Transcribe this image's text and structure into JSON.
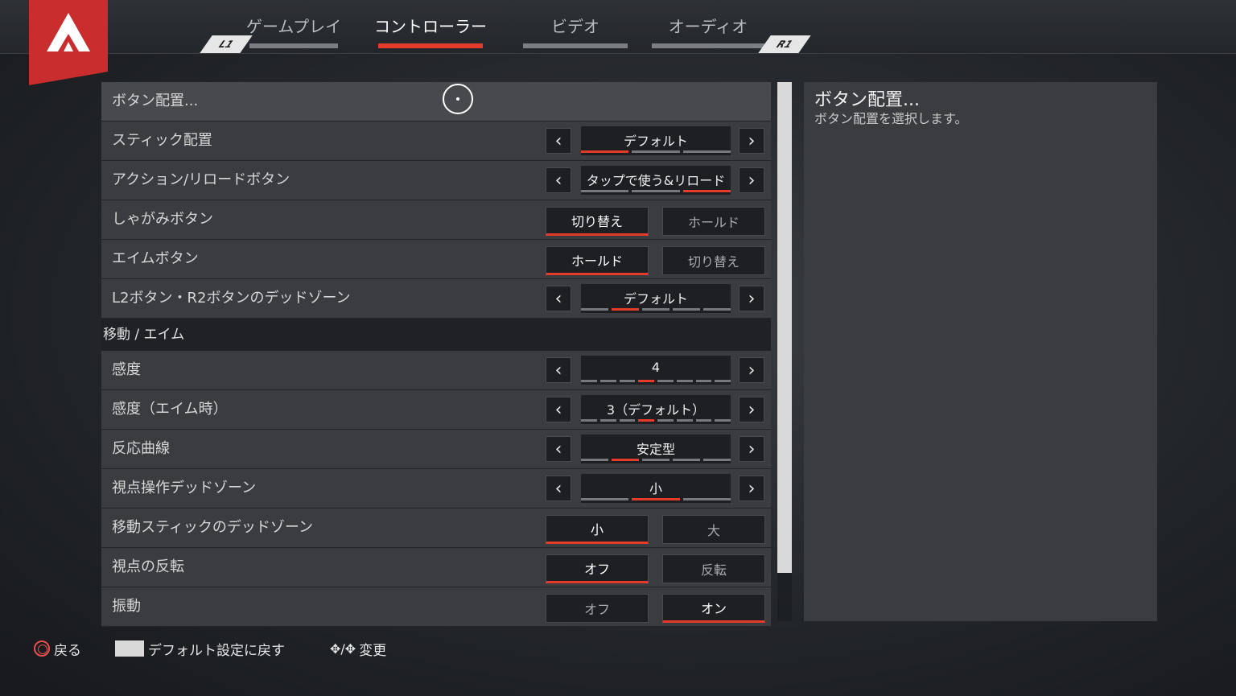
{
  "tabs": [
    {
      "label": "ゲームプレイ"
    },
    {
      "label": "コントローラー"
    },
    {
      "label": "ビデオ"
    },
    {
      "label": "オーディオ"
    }
  ],
  "shoulders": {
    "left": "L1",
    "right": "R1"
  },
  "rows_top": [
    {
      "label": "ボタン配置..."
    },
    {
      "label": "スティック配置",
      "value": "デフォルト"
    },
    {
      "label": "アクション/リロードボタン",
      "value": "タップで使う&リロード"
    },
    {
      "label": "しゃがみボタン",
      "opt_a": "切り替え",
      "opt_b": "ホールド"
    },
    {
      "label": "エイムボタン",
      "opt_a": "ホールド",
      "opt_b": "切り替え"
    },
    {
      "label": "L2ボタン・R2ボタンのデッドゾーン",
      "value": "デフォルト"
    }
  ],
  "section_move": "移動 / エイム",
  "rows_move": [
    {
      "label": "感度",
      "value": "4"
    },
    {
      "label": "感度（エイム時）",
      "value": "3（デフォルト）"
    },
    {
      "label": "反応曲線",
      "value": "安定型"
    },
    {
      "label": "視点操作デッドゾーン",
      "value": "小"
    },
    {
      "label": "移動スティックのデッドゾーン",
      "opt_a": "小",
      "opt_b": "大"
    },
    {
      "label": "視点の反転",
      "opt_a": "オフ",
      "opt_b": "反転"
    },
    {
      "label": "振動",
      "opt_a": "オフ",
      "opt_b": "オン"
    }
  ],
  "info": {
    "title": "ボタン配置...",
    "desc": "ボタン配置を選択します。"
  },
  "footer": {
    "back": "戻る",
    "reset": "デフォルト設定に戻す",
    "change": "変更"
  },
  "colors": {
    "accent": "#e53b2b",
    "brand": "#c92d2d"
  }
}
